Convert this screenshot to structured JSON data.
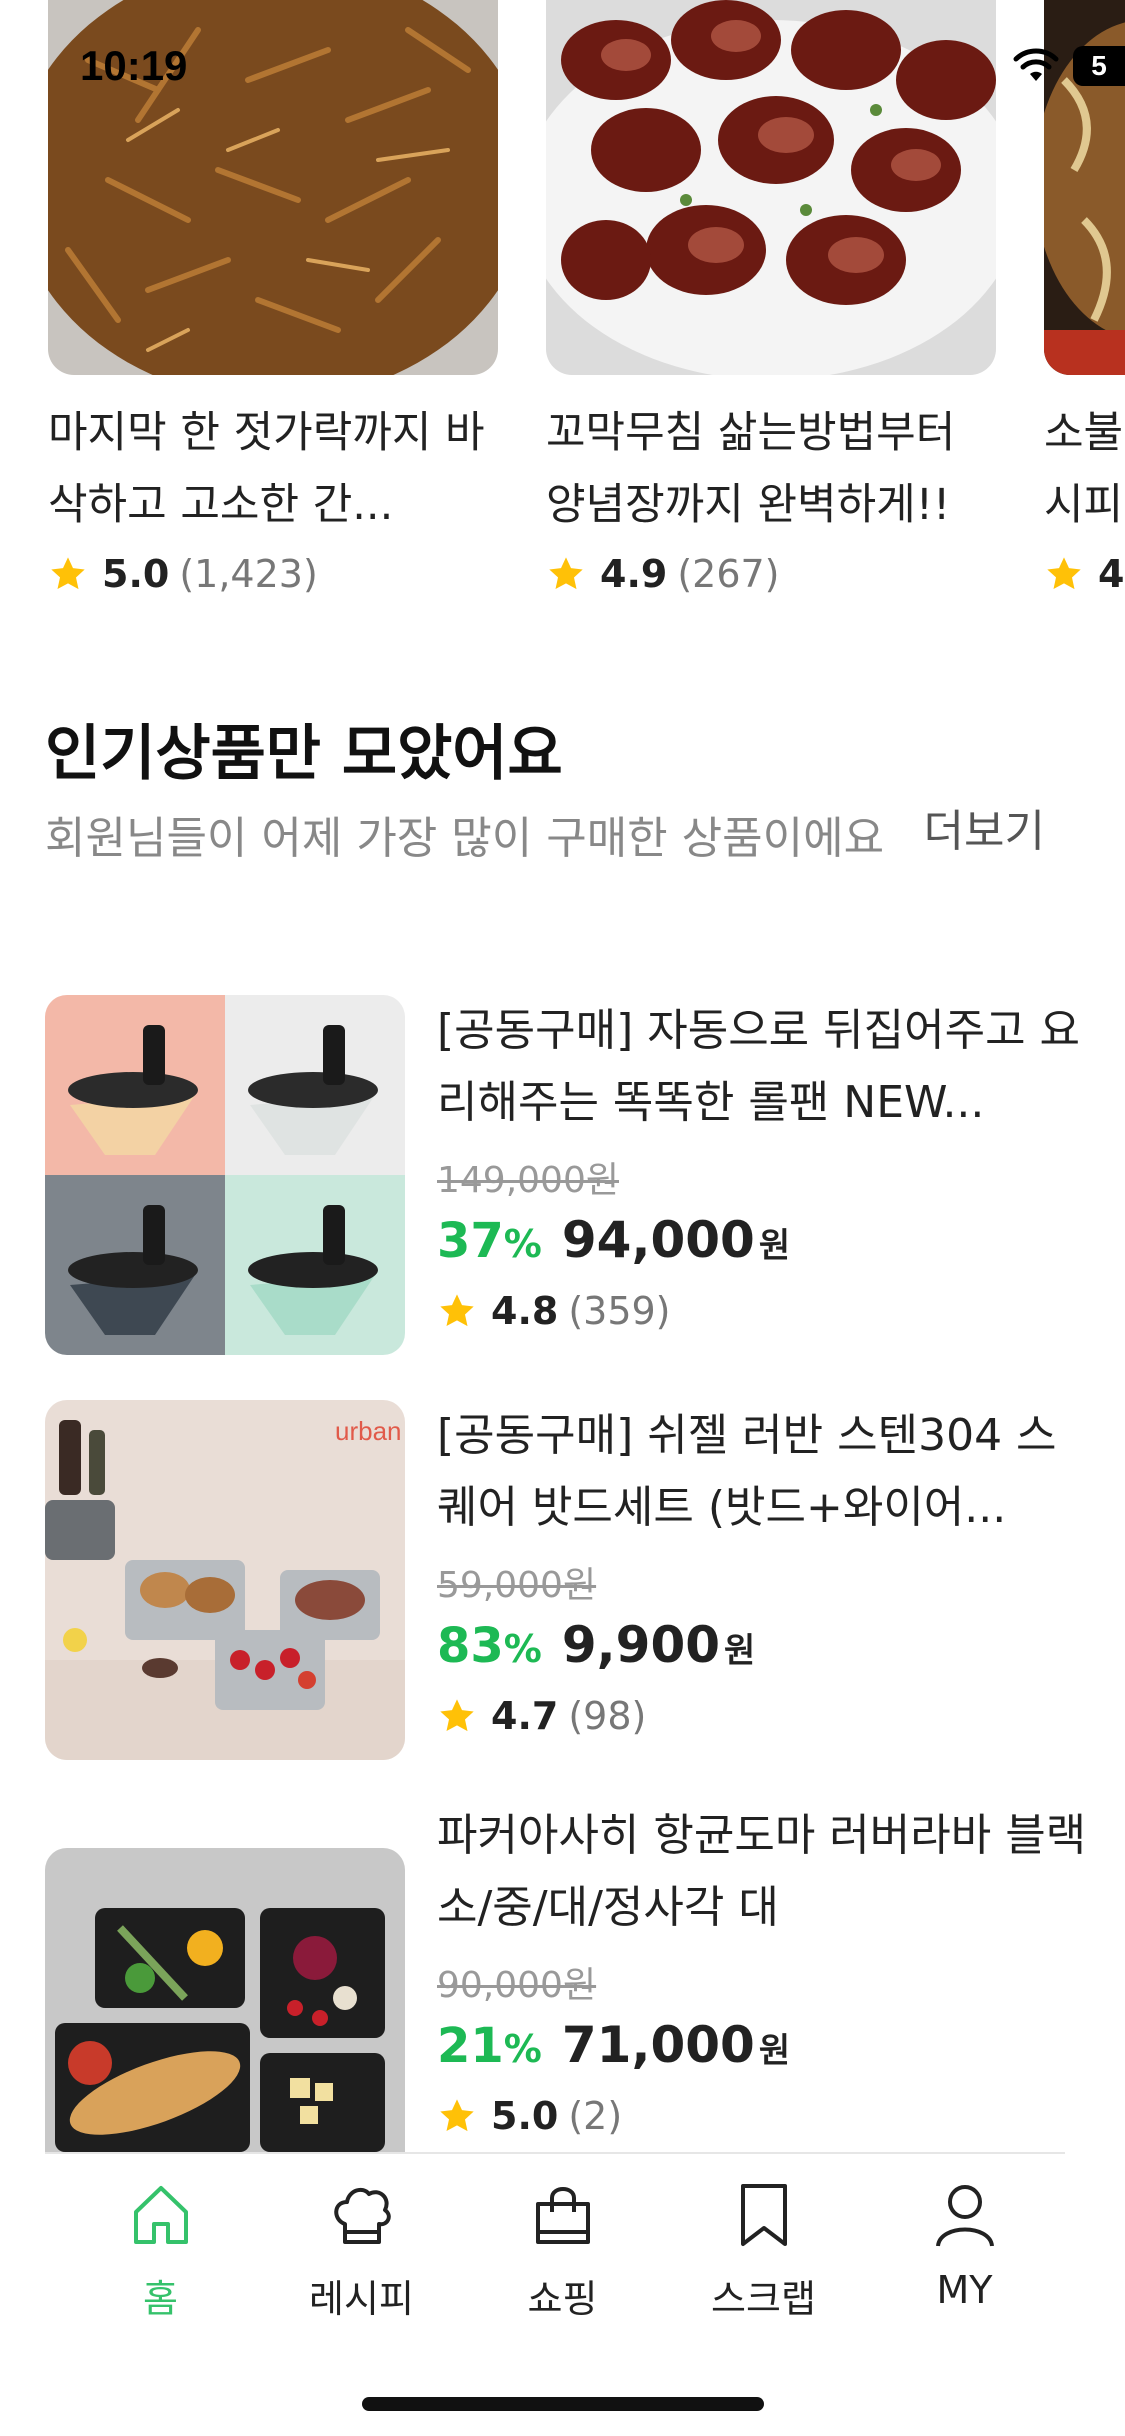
{
  "status_bar": {
    "time": "10:19",
    "battery": "5"
  },
  "recipes": [
    {
      "title": "마지막 한 젓가락까지 바삭하고 고소한 간...",
      "rating": "5.0",
      "count": "(1,423)"
    },
    {
      "title": "꼬막무침 삶는방법부터 양념장까지 완벽하게!!",
      "rating": "4.9",
      "count": "(267)"
    },
    {
      "title": "소불 시피",
      "rating": "4",
      "count": ""
    }
  ],
  "section": {
    "title": "인기상품만 모았어요",
    "subtitle": "회원님들이 어제 가장 많이 구매한 상품이에요",
    "more": "더보기"
  },
  "products": [
    {
      "title": "[공동구매] 자동으로 뒤집어주고 요리해주는 똑똑한 롤팬 NEW...",
      "original_price": "149,000원",
      "discount": "37",
      "price": "94,000",
      "rating": "4.8",
      "count": "(359)"
    },
    {
      "title": "[공동구매] 쉬젤 러반 스텐304 스퀘어 밧드세트 (밧드+와이어...",
      "original_price": "59,000원",
      "discount": "83",
      "price": "9,900",
      "rating": "4.7",
      "count": "(98)"
    },
    {
      "title": "파커아사히 항균도마 러버라바 블랙 소/중/대/정사각 대",
      "original_price": "90,000원",
      "discount": "21",
      "price": "71,000",
      "rating": "5.0",
      "count": "(2)"
    }
  ],
  "currency_unit": "원",
  "percent_sign": "%",
  "nav": [
    {
      "label": "홈",
      "icon": "home-icon",
      "active": true
    },
    {
      "label": "레시피",
      "icon": "chef-hat-icon",
      "active": false
    },
    {
      "label": "쇼핑",
      "icon": "shopping-bag-icon",
      "active": false
    },
    {
      "label": "스크랩",
      "icon": "bookmark-icon",
      "active": false
    },
    {
      "label": "MY",
      "icon": "person-icon",
      "active": false
    }
  ],
  "colors": {
    "accent": "#35c26b",
    "discount": "#1db954",
    "star": "#ffc107"
  }
}
